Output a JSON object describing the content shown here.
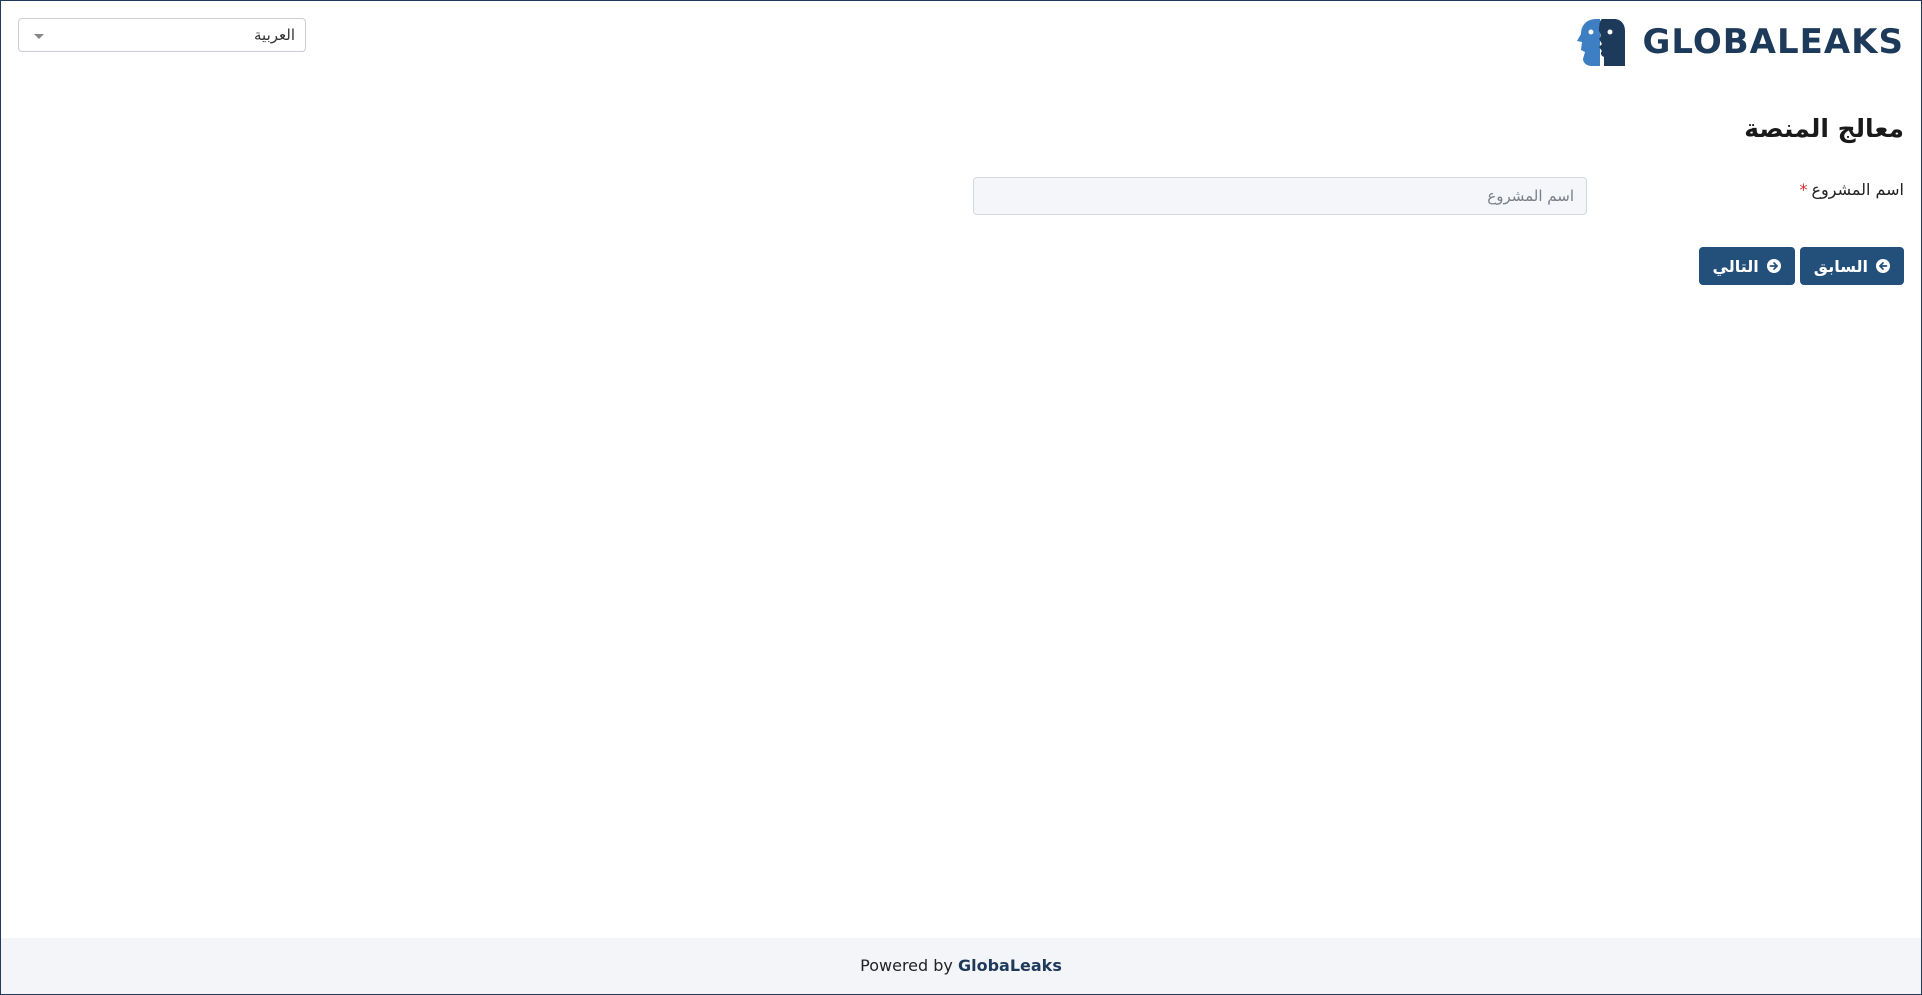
{
  "language_selector": {
    "value": "العربية"
  },
  "logo": {
    "text": "GLOBALEAKS",
    "colors": {
      "primary": "#1d3a5b",
      "accent": "#3d7fc2"
    }
  },
  "wizard": {
    "title": "معالج المنصة",
    "field": {
      "label": "اسم المشروع",
      "required_mark": "*",
      "value": "",
      "placeholder": "اسم المشروع"
    },
    "buttons": {
      "previous": {
        "label": "السابق",
        "icon": "arrow-circle-left-icon"
      },
      "next": {
        "label": "التالي",
        "icon": "arrow-circle-right-icon"
      }
    }
  },
  "footer": {
    "prefix": "Powered by ",
    "brand": "GlobaLeaks"
  },
  "colors": {
    "button_bg": "#23507b",
    "required": "#d9302c",
    "footer_bg": "#f4f5f8"
  }
}
